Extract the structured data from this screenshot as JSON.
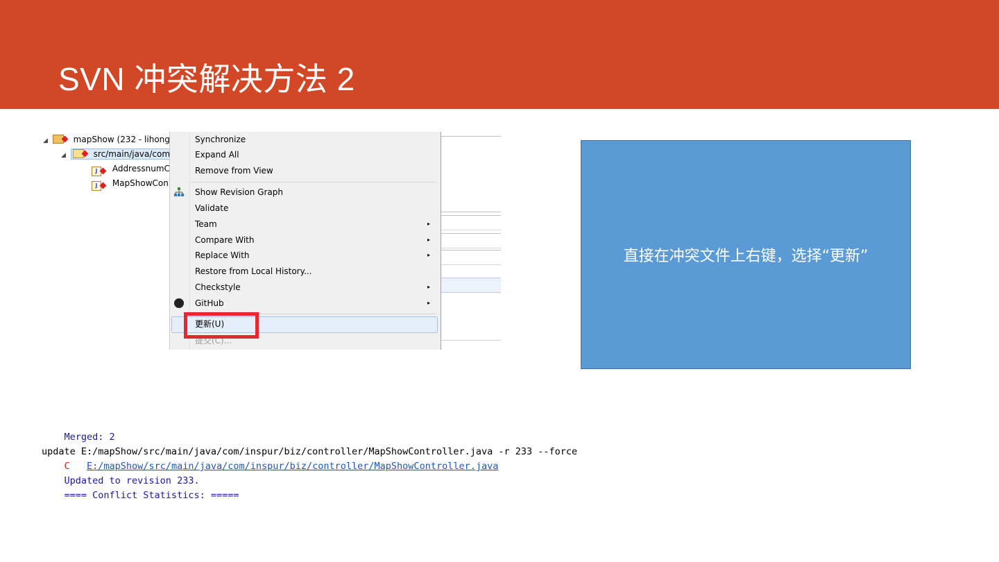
{
  "slide": {
    "title": "SVN 冲突解决方法 2",
    "accent_color": "#d24726"
  },
  "tree": {
    "items": [
      {
        "label": "mapShow (232 - lihong",
        "icon": "project-icon"
      },
      {
        "label": "src/main/java/com",
        "icon": "package-icon"
      },
      {
        "label": "AddressnumC",
        "icon": "java-file-icon"
      },
      {
        "label": "MapShowCon",
        "icon": "java-file-icon"
      }
    ]
  },
  "menu": {
    "items": [
      {
        "label": "Synchronize"
      },
      {
        "label": "Expand All"
      },
      {
        "label": "Remove from View"
      },
      {
        "label": "Show Revision Graph"
      },
      {
        "label": "Validate"
      },
      {
        "label": "Team"
      },
      {
        "label": "Compare With"
      },
      {
        "label": "Replace With"
      },
      {
        "label": "Restore from Local History..."
      },
      {
        "label": "Checkstyle"
      },
      {
        "label": "GitHub"
      },
      {
        "label": "更新(U)"
      },
      {
        "label": "提交(C)..."
      }
    ],
    "submenu_arrow": "▸"
  },
  "callout": {
    "text": "直接在冲突文件上右键，选择“更新”",
    "color": "#5b9bd5"
  },
  "console": {
    "merged": "    Merged: 2",
    "update_cmd": "update E:/mapShow/src/main/java/com/inspur/biz/controller/MapShowController.java -r 233 --force",
    "conflict_flag": "    C   ",
    "conflict_path": "E:/mapShow/src/main/java/com/inspur/biz/controller/MapShowController.java",
    "updated": "    Updated to revision 233.",
    "stats": "    ==== Conflict Statistics: ====="
  }
}
